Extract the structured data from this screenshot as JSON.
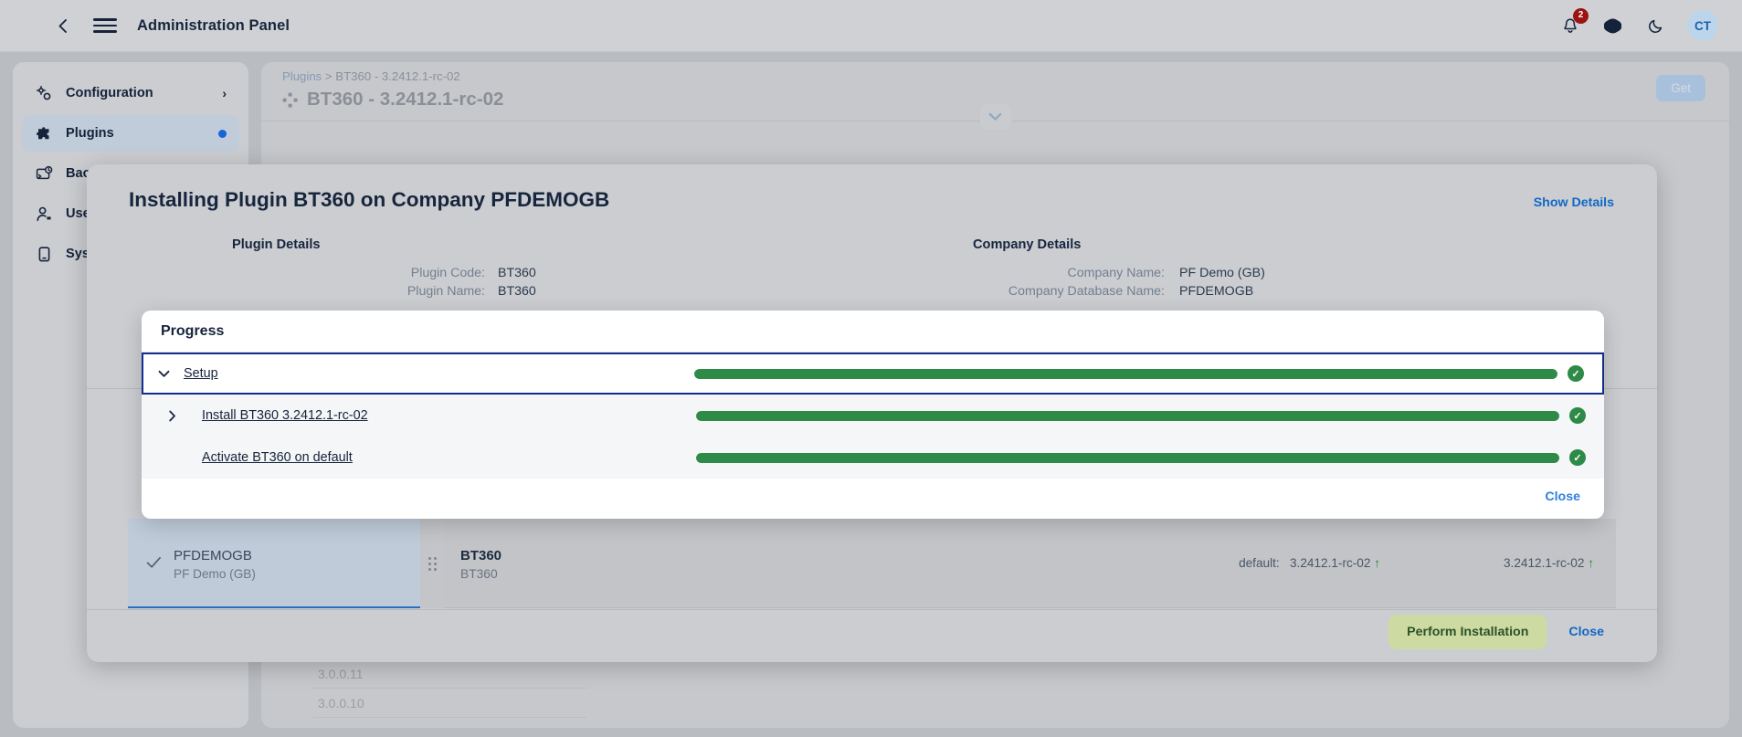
{
  "topbar": {
    "title": "Administration Panel",
    "back_icon": "chevron-left-icon",
    "menu_icon": "hamburger-menu-icon",
    "notifications": {
      "icon": "bell-icon",
      "badge": "2"
    },
    "language_icon": "globe-icon",
    "theme_icon": "moon-icon",
    "avatar_initials": "CT"
  },
  "sidebar": {
    "items": [
      {
        "label": "Configuration",
        "icon": "gears-icon",
        "trailing": "chevron-right-icon",
        "active": false
      },
      {
        "label": "Plugins",
        "icon": "puzzle-piece-icon",
        "trailing": "status-dot",
        "active": true
      },
      {
        "label": "Background Tasks",
        "icon": "background-tasks-icon",
        "trailing": "",
        "active": false
      },
      {
        "label": "Users",
        "icon": "user-icon",
        "trailing": "",
        "active": false
      },
      {
        "label": "System",
        "icon": "device-icon",
        "trailing": "",
        "active": false
      }
    ]
  },
  "content": {
    "breadcrumb_root": "Plugins",
    "breadcrumb_sep": " > ",
    "breadcrumb_current": "BT360 - 3.2412.1-rc-02",
    "page_icon": "plugin-grid-icon",
    "page_title": "BT360 - 3.2412.1-rc-02",
    "get_button": "Get",
    "collapse_icon": "chevron-down-icon",
    "background_versions": [
      "3.0.0.11",
      "3.0.0.10"
    ]
  },
  "modal": {
    "title": "Installing Plugin BT360 on Company PFDEMOGB",
    "show_details": "Show Details",
    "plugin_details": {
      "heading": "Plugin Details",
      "rows": [
        {
          "key": "Plugin Code:",
          "value": "BT360"
        },
        {
          "key": "Plugin Name:",
          "value": "BT360"
        }
      ]
    },
    "company_details": {
      "heading": "Company Details",
      "rows": [
        {
          "key": "Company Name:",
          "value": "PF Demo (GB)"
        },
        {
          "key": "Company Database Name:",
          "value": "PFDEMOGB"
        }
      ]
    },
    "selection": {
      "check_icon": "check-icon",
      "company_code": "PFDEMOGB",
      "company_name": "PF Demo (GB)",
      "grip_icon": "drag-handle-icon",
      "plugin_code": "BT360",
      "plugin_name": "BT360",
      "default_label": "default:",
      "default_version": "3.2412.1-rc-02",
      "default_arrow": "arrow-up-icon",
      "available_version": "3.2412.1-rc-02",
      "available_arrow": "arrow-up-icon"
    },
    "footer": {
      "primary": "Perform Installation",
      "secondary": "Close"
    }
  },
  "progress_dialog": {
    "title": "Progress",
    "rows": [
      {
        "label": "Setup",
        "caret": "chevron-down-icon",
        "expanded": true,
        "selected": true,
        "indent": false,
        "percent": 100,
        "status_icon": "check-circle-icon"
      },
      {
        "label": "Install BT360 3.2412.1-rc-02",
        "caret": "chevron-right-icon",
        "expanded": false,
        "selected": false,
        "indent": true,
        "percent": 100,
        "status_icon": "check-circle-icon"
      },
      {
        "label": "Activate BT360 on default",
        "caret": "",
        "expanded": false,
        "selected": false,
        "indent": true,
        "percent": 100,
        "status_icon": "check-circle-icon"
      }
    ],
    "close_label": "Close"
  },
  "colors": {
    "accent_blue": "#1268c7",
    "progress_green": "#2d8a47",
    "selected_border": "#142d8c",
    "badge_red": "#9b1313",
    "primary_button_bg": "#cddaa2"
  }
}
